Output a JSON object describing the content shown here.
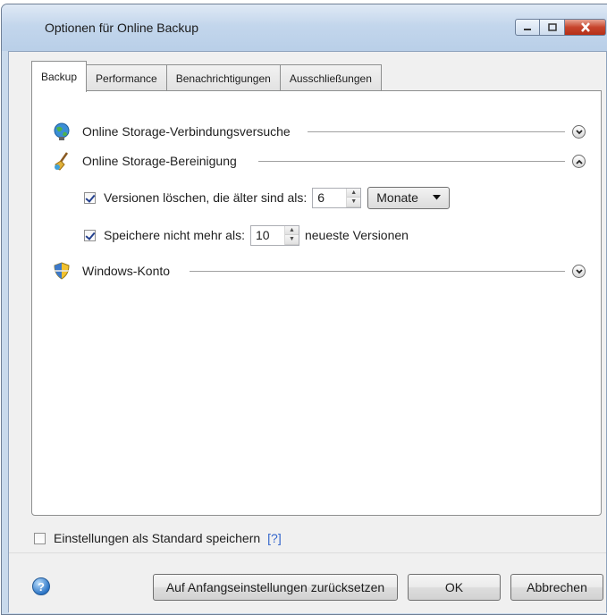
{
  "window": {
    "title": "Optionen für Online Backup"
  },
  "tabs": [
    {
      "label": "Backup",
      "active": true
    },
    {
      "label": "Performance",
      "active": false
    },
    {
      "label": "Benachrichtigungen",
      "active": false
    },
    {
      "label": "Ausschließungen",
      "active": false
    }
  ],
  "sections": {
    "connection": {
      "title": "Online Storage-Verbindungsversuche",
      "icon": "globe-network-icon",
      "expanded": false
    },
    "cleanup": {
      "title": "Online Storage-Bereinigung",
      "icon": "broom-icon",
      "expanded": true
    },
    "account": {
      "title": "Windows-Konto",
      "icon": "shield-icon",
      "expanded": false
    }
  },
  "cleanup": {
    "delete_older": {
      "checked": true,
      "label": "Versionen löschen, die älter sind als:",
      "value": "6",
      "unit": "Monate"
    },
    "keep_max": {
      "checked": true,
      "label": "Speichere nicht mehr als:",
      "value": "10",
      "suffix": "neueste Versionen"
    }
  },
  "save_default": {
    "checked": false,
    "label": "Einstellungen als Standard speichern",
    "help_link": "[?]"
  },
  "buttons": {
    "reset": "Auf Anfangseinstellungen zurücksetzen",
    "ok": "OK",
    "cancel": "Abbrechen"
  },
  "colors": {
    "titlebar": "#c3d6ec",
    "close_button": "#c7452c",
    "link": "#3366cc"
  }
}
